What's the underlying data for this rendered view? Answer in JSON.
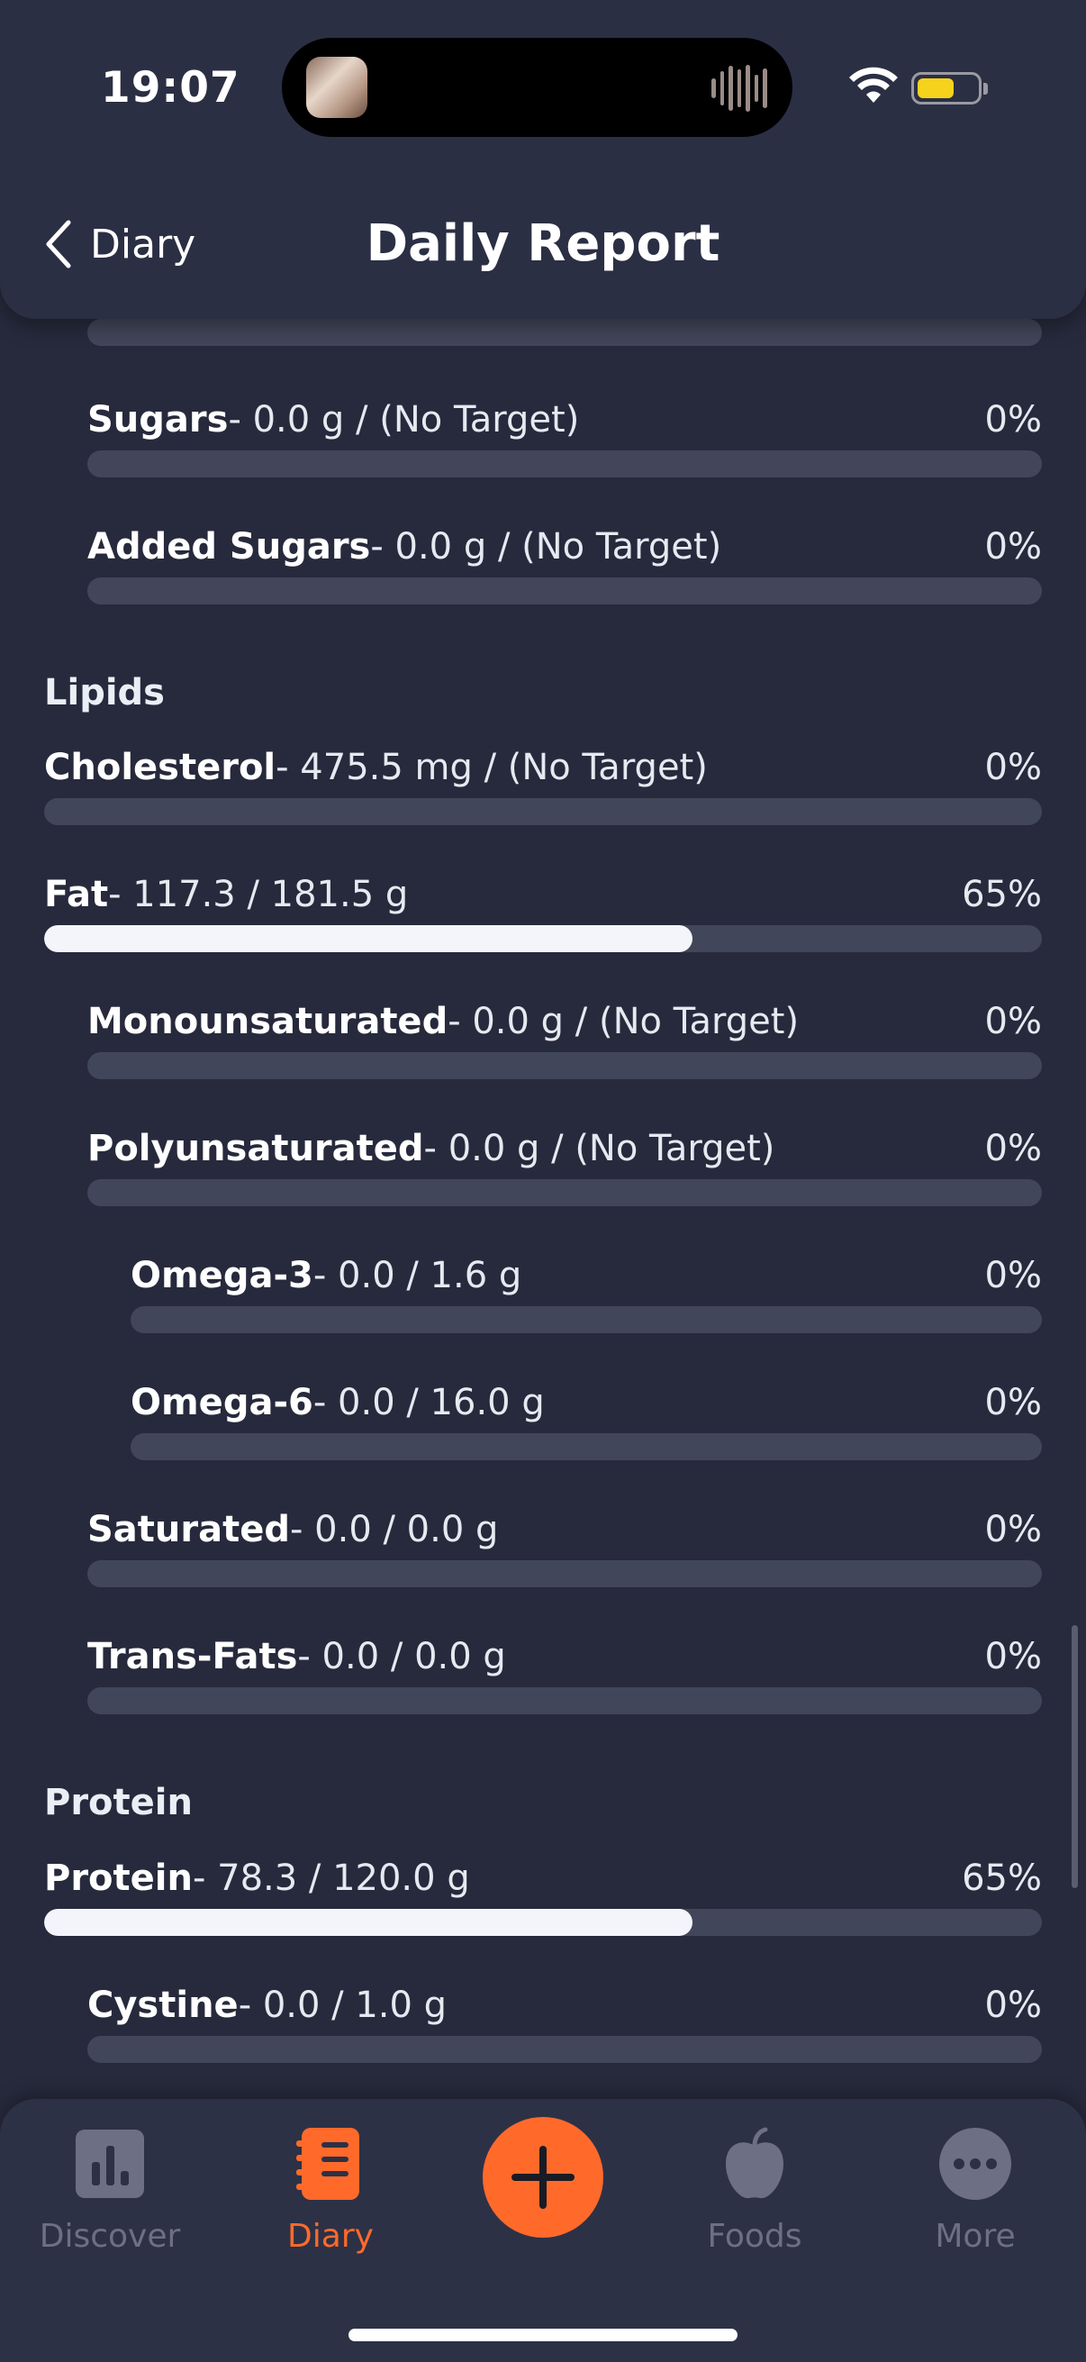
{
  "status": {
    "time": "19:07"
  },
  "header": {
    "back_label": "Diary",
    "title": "Daily Report"
  },
  "sections": {
    "lipids": "Lipids",
    "protein": "Protein"
  },
  "rows": {
    "prev": {
      "name": "",
      "value": "",
      "pct": "",
      "progress": 0
    },
    "sugars": {
      "name": "Sugars",
      "value": "- 0.0 g / (No Target)",
      "pct": "0%",
      "progress": 0
    },
    "added_sugars": {
      "name": "Added Sugars",
      "value": "- 0.0 g / (No Target)",
      "pct": "0%",
      "progress": 0
    },
    "cholesterol": {
      "name": "Cholesterol",
      "value": "- 475.5 mg / (No Target)",
      "pct": "0%",
      "progress": 0
    },
    "fat": {
      "name": "Fat",
      "value": "- 117.3 / 181.5 g",
      "pct": "65%",
      "progress": 0.65
    },
    "monounsaturated": {
      "name": "Monounsaturated",
      "value": "- 0.0 g / (No Target)",
      "pct": "0%",
      "progress": 0
    },
    "polyunsaturated": {
      "name": "Polyunsaturated",
      "value": "- 0.0 g / (No Target)",
      "pct": "0%",
      "progress": 0
    },
    "omega3": {
      "name": "Omega-3",
      "value": "- 0.0 / 1.6 g",
      "pct": "0%",
      "progress": 0
    },
    "omega6": {
      "name": "Omega-6",
      "value": "- 0.0 / 16.0 g",
      "pct": "0%",
      "progress": 0
    },
    "saturated": {
      "name": "Saturated",
      "value": "- 0.0 / 0.0 g",
      "pct": "0%",
      "progress": 0
    },
    "trans_fats": {
      "name": "Trans-Fats",
      "value": "- 0.0 / 0.0 g",
      "pct": "0%",
      "progress": 0
    },
    "protein": {
      "name": "Protein",
      "value": "- 78.3 / 120.0 g",
      "pct": "65%",
      "progress": 0.65
    },
    "cystine": {
      "name": "Cystine",
      "value": "- 0.0 / 1.0 g",
      "pct": "0%",
      "progress": 0
    }
  },
  "tabbar": {
    "discover": "Discover",
    "diary": "Diary",
    "foods": "Foods",
    "more": "More",
    "active": "diary"
  },
  "colors": {
    "background": "#272a3c",
    "accent": "#ff6a2b",
    "bar_track": "#42465a",
    "bar_fill": "#f4f5fa"
  }
}
